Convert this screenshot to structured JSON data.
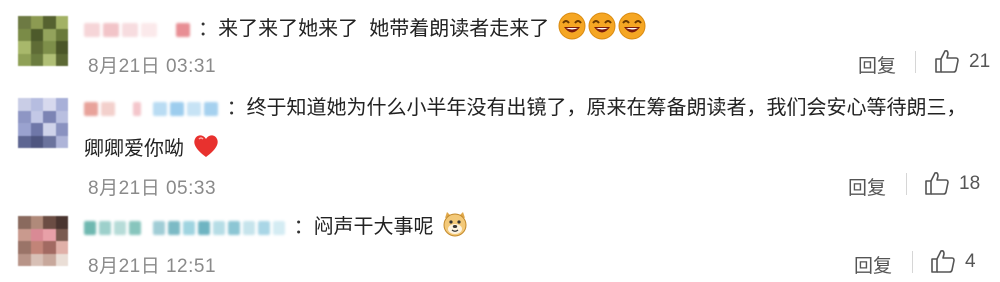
{
  "comments": [
    {
      "text": "来了来了她来了  她带着朗读者走来了",
      "timestamp": "8月21日 03:31",
      "reply_label": "回复",
      "like_count": "21",
      "emoji": "laughing-face x3"
    },
    {
      "text": "终于知道她为什么小半年没有出镜了，原来在筹备朗读者，我们会安心等待朗三，",
      "text_line2": "卿卿爱你呦",
      "timestamp": "8月21日 05:33",
      "reply_label": "回复",
      "like_count": "18",
      "emoji": "red-heart"
    },
    {
      "text": "闷声干大事呢",
      "timestamp": "8月21日 12:51",
      "reply_label": "回复",
      "like_count": "4",
      "emoji": "doge-face"
    }
  ],
  "colors": {
    "text": "#222222",
    "timestamp": "#8a8a8a",
    "heart": "#e8312e",
    "emoji_face": "#f5a623"
  }
}
